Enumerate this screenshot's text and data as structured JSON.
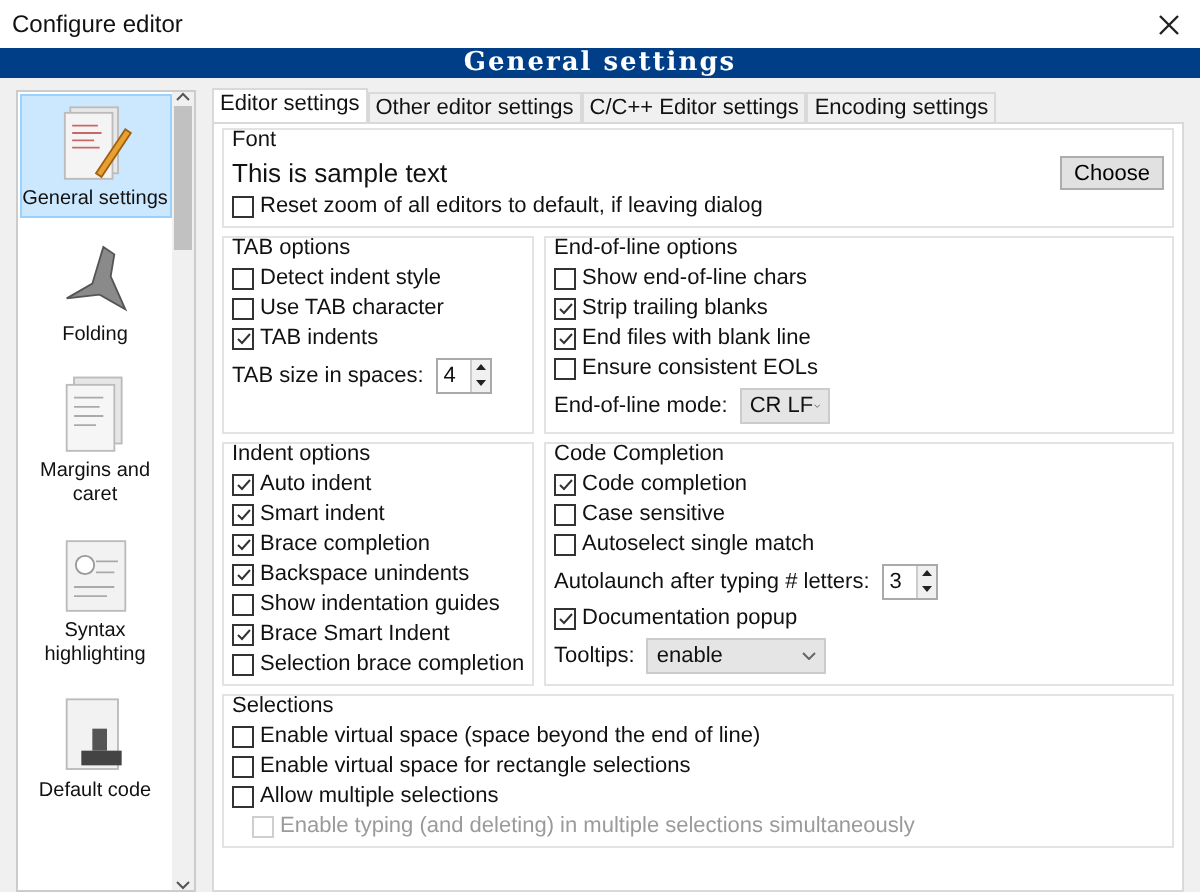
{
  "window": {
    "title": "Configure editor"
  },
  "header": "General settings",
  "sidebar": {
    "items": [
      {
        "label": "General settings",
        "selected": true
      },
      {
        "label": "Folding",
        "selected": false
      },
      {
        "label": "Margins and caret",
        "selected": false
      },
      {
        "label": "Syntax highlighting",
        "selected": false
      },
      {
        "label": "Default code",
        "selected": false
      }
    ]
  },
  "tabs": [
    {
      "label": "Editor settings",
      "selected": true
    },
    {
      "label": "Other editor settings",
      "selected": false
    },
    {
      "label": "C/C++ Editor settings",
      "selected": false
    },
    {
      "label": "Encoding settings",
      "selected": false
    }
  ],
  "font": {
    "title": "Font",
    "sample": "This is sample text",
    "button": "Choose",
    "reset_zoom": {
      "label": "Reset zoom of all editors to default, if leaving dialog",
      "checked": false
    }
  },
  "tab_options": {
    "title": "TAB options",
    "items": [
      {
        "kind": "check",
        "label": "Detect indent style",
        "checked": false
      },
      {
        "kind": "check",
        "label": "Use TAB character",
        "checked": false
      },
      {
        "kind": "check",
        "label": "TAB indents",
        "checked": true
      },
      {
        "kind": "spin",
        "label": "TAB size in spaces:",
        "value": "4"
      }
    ]
  },
  "eol_options": {
    "title": "End-of-line options",
    "items": [
      {
        "kind": "check",
        "label": "Show end-of-line chars",
        "checked": false
      },
      {
        "kind": "check",
        "label": "Strip trailing blanks",
        "checked": true
      },
      {
        "kind": "check",
        "label": "End files with blank line",
        "checked": true
      },
      {
        "kind": "check",
        "label": "Ensure consistent EOLs",
        "checked": false
      },
      {
        "kind": "select",
        "label": "End-of-line mode:",
        "value": "CR LF"
      }
    ]
  },
  "indent_options": {
    "title": "Indent options",
    "items": [
      {
        "kind": "check",
        "label": "Auto indent",
        "checked": true
      },
      {
        "kind": "check",
        "label": "Smart indent",
        "checked": true
      },
      {
        "kind": "check",
        "label": "Brace completion",
        "checked": true
      },
      {
        "kind": "check",
        "label": "Backspace unindents",
        "checked": true
      },
      {
        "kind": "check",
        "label": "Show indentation guides",
        "checked": false
      },
      {
        "kind": "check",
        "label": "Brace Smart Indent",
        "checked": true
      },
      {
        "kind": "check",
        "label": "Selection brace completion",
        "checked": false
      }
    ]
  },
  "code_completion": {
    "title": "Code Completion",
    "items": [
      {
        "kind": "check",
        "label": "Code completion",
        "checked": true
      },
      {
        "kind": "check",
        "label": "Case sensitive",
        "checked": false
      },
      {
        "kind": "check",
        "label": "Autoselect single match",
        "checked": false
      },
      {
        "kind": "spin",
        "label": "Autolaunch after typing # letters:",
        "value": "3"
      },
      {
        "kind": "check",
        "label": "Documentation popup",
        "checked": true
      },
      {
        "kind": "select",
        "label": "Tooltips:",
        "value": "enable"
      }
    ]
  },
  "selections": {
    "title": "Selections",
    "items": [
      {
        "kind": "check",
        "label": "Enable virtual space (space beyond the end of line)",
        "checked": false,
        "disabled": false
      },
      {
        "kind": "check",
        "label": "Enable virtual space for rectangle selections",
        "checked": false,
        "disabled": false
      },
      {
        "kind": "check",
        "label": "Allow multiple selections",
        "checked": false,
        "disabled": false,
        "children": [
          {
            "kind": "check",
            "label": "Enable typing (and deleting) in multiple selections simultaneously",
            "checked": false,
            "disabled": true
          }
        ]
      }
    ]
  }
}
